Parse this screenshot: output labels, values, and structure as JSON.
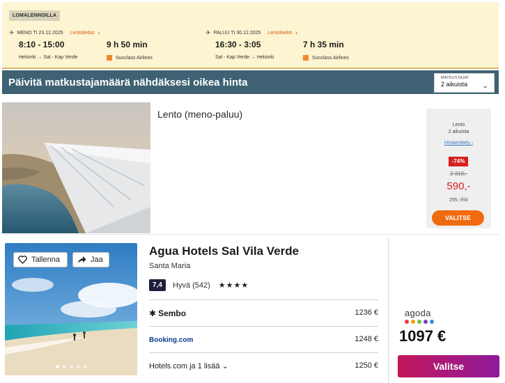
{
  "flight_summary": {
    "holiday_tag": "LOMALENNOILLA",
    "outbound": {
      "header": "MENO TI 23.12.2025",
      "details_link": "Lentotiedot",
      "time": "8:10 - 15:00",
      "duration": "9 h 50 min",
      "route": "Helsinki → Sal - Kap Verde",
      "airline": "Sunclass Airlines"
    },
    "return": {
      "header": "PALUU TI 30.12.2025",
      "details_link": "Lentotiedot",
      "time": "16:30 - 3:05",
      "duration": "7 h 35 min",
      "route": "Sal - Kap Verde → Helsinki",
      "airline": "Sunclass Airlines"
    }
  },
  "travellers_banner": {
    "text": "Päivitä matkustajamäärä nähdäksesi oikea hinta",
    "selector_label": "MATKUSTAJAT",
    "selector_value": "2 aikuista"
  },
  "flight_card": {
    "title": "Lento (meno-paluu)",
    "price_box": {
      "type": "Lento",
      "travellers": "2 aikuista",
      "price_details_link": "Hintaerittely",
      "discount": "-74%",
      "old_price": "2 310,-",
      "price": "590,-",
      "per_person": "295,-/hlö",
      "button": "VALITSE"
    }
  },
  "hotel_card": {
    "save_label": "Tallenna",
    "share_label": "Jaa",
    "name": "Agua Hotels Sal Vila Verde",
    "location": "Santa Maria",
    "rating_score": "7,4",
    "rating_text": "Hyvä (542)",
    "stars": "★★★★",
    "offers": [
      {
        "provider": "Sembo",
        "price": "1236 €"
      },
      {
        "provider": "Booking.com",
        "price": "1248 €"
      },
      {
        "provider": "Hotels.com ja 1 lisää",
        "price": "1250 €"
      }
    ],
    "best_provider": "agoda",
    "best_price": "1097 €",
    "select_label": "Valitse"
  },
  "colors": {
    "accent_orange": "#f06a0f",
    "discount_red": "#d61f1f",
    "banner_blue": "#3e6273",
    "select_gradient_start": "#c2185b",
    "select_gradient_end": "#8e1a9c"
  }
}
